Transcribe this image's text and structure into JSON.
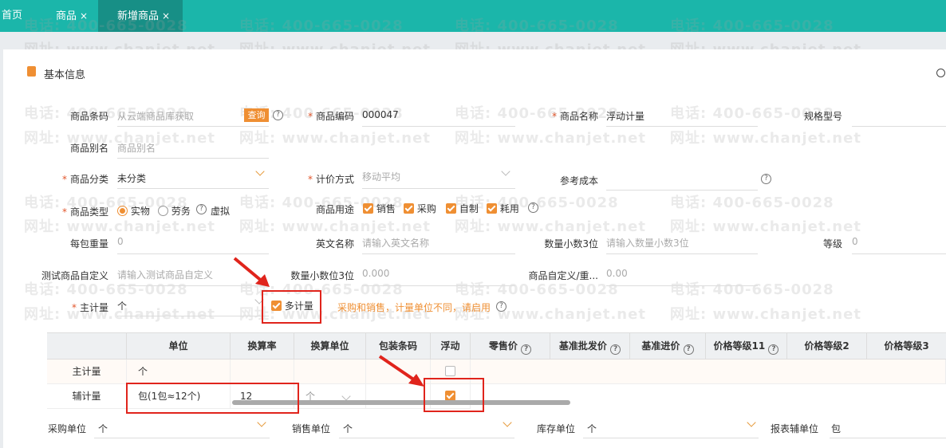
{
  "tabs": [
    {
      "label": "首页"
    },
    {
      "label": "商品",
      "close": "×"
    },
    {
      "label": "新增商品",
      "close": "×"
    }
  ],
  "section": {
    "title": "基本信息"
  },
  "watermark": {
    "phone": "电话: 400-665-0028",
    "web": "网址: www.chanjet.net"
  },
  "form": {
    "barcode_label": "商品条码",
    "barcode_placeholder": "从云端商品库获取",
    "query_button": "查询",
    "code_label": "商品编码",
    "code_value": "000047",
    "name_label": "商品名称",
    "name_value": "浮动计量",
    "spec_label": "规格型号",
    "alias_label": "商品别名",
    "alias_placeholder": "商品别名",
    "category_label": "商品分类",
    "category_value": "未分类",
    "pricing_label": "计价方式",
    "pricing_value": "移动平均",
    "refcost_label": "参考成本",
    "type_label": "商品类型",
    "type_options": [
      "实物",
      "劳务",
      "虚拟"
    ],
    "type_selected": "实物",
    "usage_label": "商品用途",
    "usage_options": [
      "销售",
      "采购",
      "自制",
      "耗用"
    ],
    "weight_label": "每包重量",
    "weight_value": "0",
    "en_label": "英文名称",
    "en_placeholder": "请输入英文名称",
    "qty3_label": "数量小数3位",
    "qty3_placeholder": "请输入数量小数3位",
    "grade_label": "等级",
    "grade_value": "0",
    "custom_label": "测试商品自定义",
    "custom_placeholder": "请输入测试商品自定义",
    "qtyd3_label": "数量小数位3位",
    "qtyd3_value": "0.000",
    "custom2_label": "商品自定义/重...",
    "custom2_value": "0.00",
    "main_unit_label": "主计量",
    "main_unit_value": "个",
    "multi_unit_label": "多计量",
    "multi_unit_hint": "采购和销售，计量单位不同，请启用"
  },
  "unit_table": {
    "headers": [
      "单位",
      "换算率",
      "换算单位",
      "包装条码",
      "浮动",
      "零售价",
      "基准批发价",
      "基准进价",
      "价格等级11",
      "价格等级2",
      "价格等级3"
    ],
    "rows": [
      {
        "label": "主计量",
        "unit": "个",
        "rate": "",
        "conv_unit": "",
        "floating": false
      },
      {
        "label": "辅计量",
        "unit": "包(1包≈12个)",
        "rate": "12",
        "conv_unit": "个",
        "floating": true
      }
    ]
  },
  "footer": {
    "purchase_unit_label": "采购单位",
    "purchase_unit_value": "个",
    "sales_unit_label": "销售单位",
    "sales_unit_value": "个",
    "stock_unit_label": "库存单位",
    "stock_unit_value": "个",
    "report_unit_label": "报表辅单位",
    "report_unit_value": "包"
  },
  "colors": {
    "tabbar": "#1bb6aa",
    "tab_active": "#178f86",
    "accent": "#ef8f33",
    "required": "#e2562c",
    "annotation": "#e0241c"
  }
}
